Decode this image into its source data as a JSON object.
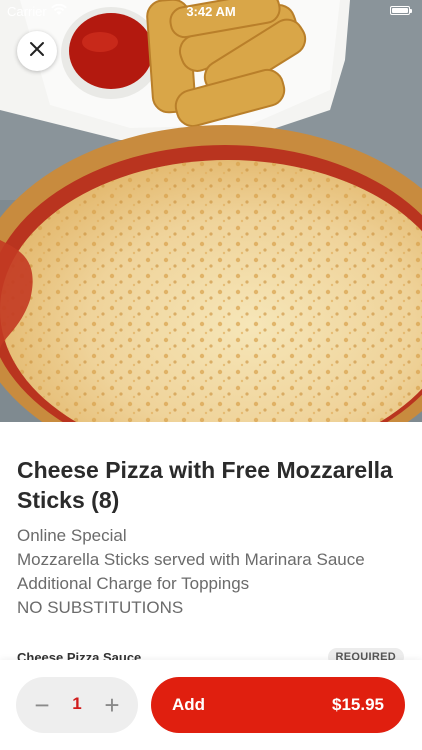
{
  "status_bar": {
    "carrier": "Carrier",
    "time": "3:42 AM"
  },
  "hero": {
    "icons": [
      "wifi-icon",
      "battery-icon",
      "close-icon"
    ]
  },
  "product": {
    "title": "Cheese Pizza with Free Mozzarella Sticks (8)",
    "description_lines": [
      "Online Special",
      "Mozzarella Sticks served with Marinara Sauce",
      "Additional Charge for Toppings",
      "NO SUBSTITUTIONS"
    ]
  },
  "options": {
    "section_label": "Cheese Pizza Sauce",
    "required_label": "REQUIRED"
  },
  "bottom_bar": {
    "quantity": "1",
    "minus_symbol": "−",
    "plus_symbol": "+",
    "add_label": "Add",
    "price": "$15.95"
  },
  "colors": {
    "accent": "#e01f0f",
    "quantity_text": "#d01c1c"
  }
}
